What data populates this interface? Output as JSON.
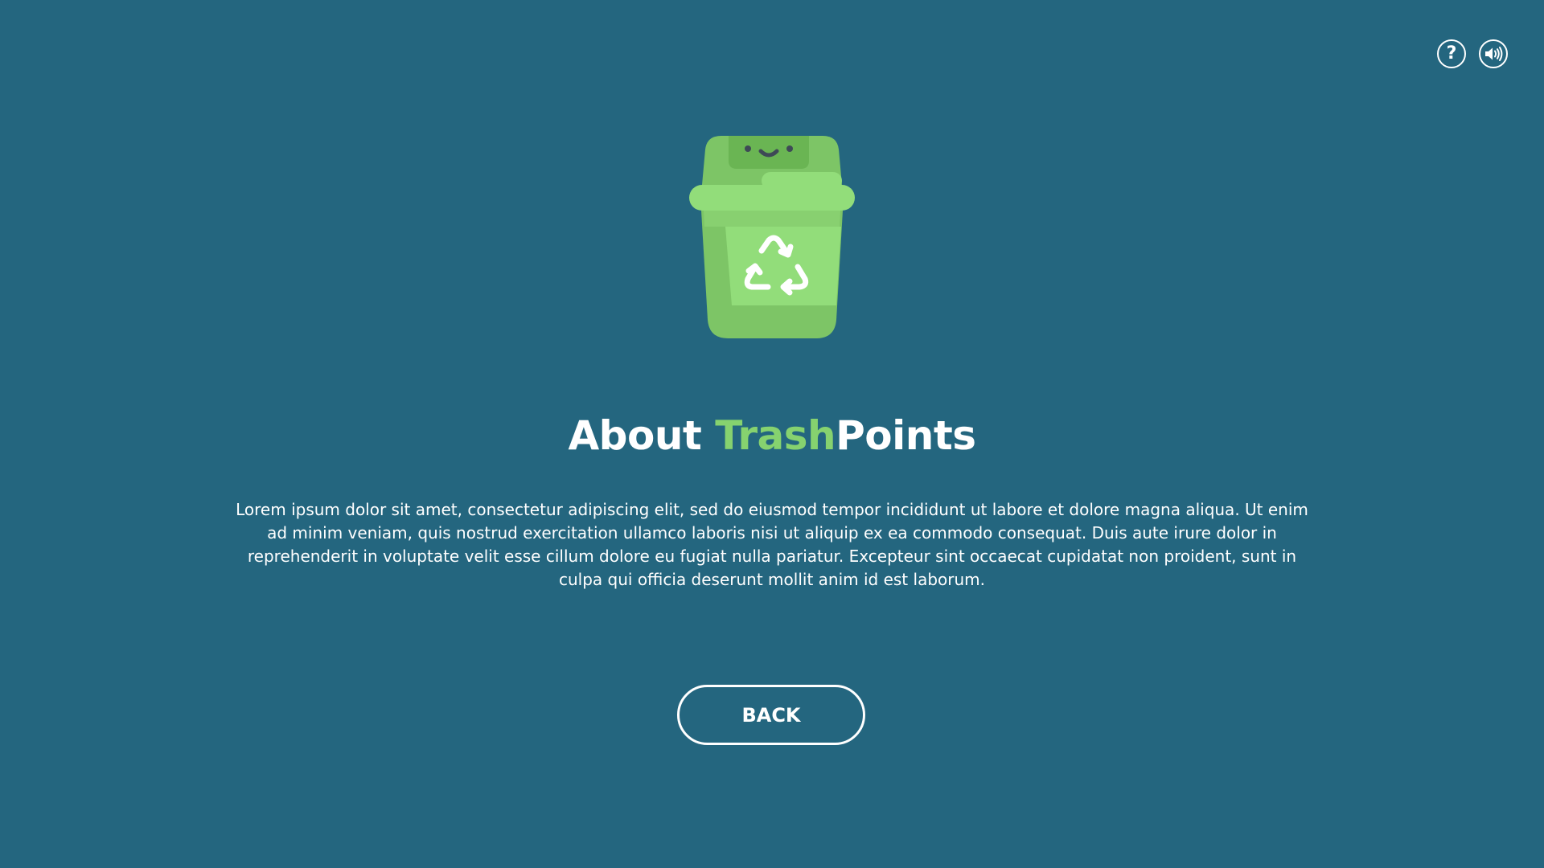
{
  "header": {
    "help_icon": "help-circle-icon",
    "help_glyph": "?",
    "sound_icon": "speaker-volume-icon"
  },
  "hero": {
    "icon": "recycle-bin-icon",
    "colors": {
      "bin_light": "#92dd7a",
      "bin_mid": "#7dc566",
      "bin_dark": "#6ab553",
      "face": "#3e4a56"
    }
  },
  "title": {
    "prefix": "About ",
    "accent": "Trash",
    "suffix": "Points",
    "accent_color": "#86d26f"
  },
  "description": "Lorem ipsum dolor sit amet, consectetur adipiscing elit, sed do eiusmod tempor incididunt ut labore et dolore magna aliqua. Ut enim ad minim veniam, quis nostrud exercitation ullamco laboris nisi ut aliquip ex ea commodo consequat. Duis aute irure dolor in reprehenderit in voluptate velit esse cillum dolore eu fugiat nulla pariatur. Excepteur sint occaecat cupidatat non proident, sunt in culpa qui officia deserunt mollit anim id est laborum.",
  "actions": {
    "back_label": "BACK"
  },
  "theme": {
    "background": "#24667f",
    "text": "#ffffff"
  }
}
